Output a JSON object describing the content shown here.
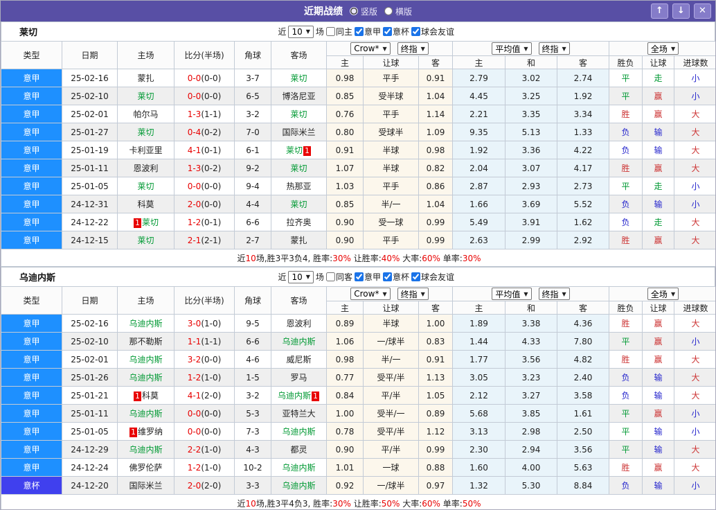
{
  "titlebar": {
    "title": "近期战绩",
    "radio_vertical": "竖版",
    "radio_horizontal": "横版",
    "radio_checked": "checked",
    "up_icon": "↑",
    "down_icon": "↓",
    "close_icon": "✕"
  },
  "colors": {
    "titlebar_bg": "#584fa5",
    "button_bg": "#857cc9",
    "serie_a_bg": "#1e90ff",
    "cup_bg": "#4040ee",
    "focus_team_green": "#009933",
    "score_red": "#e80000",
    "result_red": "#cc3333",
    "result_green": "#009933",
    "result_blue": "#2525cc",
    "odds_col_bg": "#fcf7ec",
    "avg_col_bg": "#e9f4fa"
  },
  "filter": {
    "near_label": "近",
    "count_value": "10",
    "games_label": "场",
    "on": "checked",
    "leagues": [
      "意甲",
      "意杯",
      "球会友谊"
    ]
  },
  "columns": {
    "type": "类型",
    "date": "日期",
    "home": "主场",
    "score": "比分(半场)",
    "corner": "角球",
    "away": "客场",
    "crown_select": "Crow*",
    "final_select": "终指",
    "avg_select": "平均值",
    "full_select": "全场",
    "odds_home": "主",
    "odds_line": "让球",
    "odds_away": "客",
    "avg_home": "主",
    "avg_draw": "和",
    "avg_away": "客",
    "res_outcome": "胜负",
    "res_handicap": "让球",
    "res_goals": "进球数"
  },
  "tables": [
    {
      "team": "莱切",
      "same_label": "同主",
      "rows": [
        {
          "type": "意甲",
          "tclass": "jia",
          "date": "25-02-16",
          "home": {
            "n": "蒙扎",
            "g": false
          },
          "score": "0-0",
          "half": "(0-0)",
          "corner": "3-7",
          "away": {
            "n": "莱切",
            "g": true
          },
          "odds": [
            "0.98",
            "平手",
            "0.91"
          ],
          "avg": [
            "2.79",
            "3.02",
            "2.74"
          ],
          "res": [
            {
              "t": "平",
              "c": "g"
            },
            {
              "t": "走",
              "c": "g"
            },
            {
              "t": "小",
              "c": "b"
            }
          ]
        },
        {
          "type": "意甲",
          "tclass": "jia",
          "date": "25-02-10",
          "home": {
            "n": "莱切",
            "g": true
          },
          "score": "0-0",
          "half": "(0-0)",
          "corner": "6-5",
          "away": {
            "n": "博洛尼亚",
            "g": false
          },
          "odds": [
            "0.85",
            "受半球",
            "1.04"
          ],
          "avg": [
            "4.45",
            "3.25",
            "1.92"
          ],
          "res": [
            {
              "t": "平",
              "c": "g"
            },
            {
              "t": "赢",
              "c": "r"
            },
            {
              "t": "小",
              "c": "b"
            }
          ]
        },
        {
          "type": "意甲",
          "tclass": "jia",
          "date": "25-02-01",
          "home": {
            "n": "帕尔马",
            "g": false
          },
          "score": "1-3",
          "half": "(1-1)",
          "corner": "3-2",
          "away": {
            "n": "莱切",
            "g": true
          },
          "odds": [
            "0.76",
            "平手",
            "1.14"
          ],
          "avg": [
            "2.21",
            "3.35",
            "3.34"
          ],
          "res": [
            {
              "t": "胜",
              "c": "r"
            },
            {
              "t": "赢",
              "c": "r"
            },
            {
              "t": "大",
              "c": "r"
            }
          ]
        },
        {
          "type": "意甲",
          "tclass": "jia",
          "date": "25-01-27",
          "home": {
            "n": "莱切",
            "g": true
          },
          "score": "0-4",
          "half": "(0-2)",
          "corner": "7-0",
          "away": {
            "n": "国际米兰",
            "g": false
          },
          "odds": [
            "0.80",
            "受球半",
            "1.09"
          ],
          "avg": [
            "9.35",
            "5.13",
            "1.33"
          ],
          "res": [
            {
              "t": "负",
              "c": "b"
            },
            {
              "t": "输",
              "c": "b"
            },
            {
              "t": "大",
              "c": "r"
            }
          ]
        },
        {
          "type": "意甲",
          "tclass": "jia",
          "date": "25-01-19",
          "home": {
            "n": "卡利亚里",
            "g": false
          },
          "score": "4-1",
          "half": "(0-1)",
          "corner": "6-1",
          "away": {
            "n": "莱切",
            "g": true,
            "badge": "1",
            "bpos": "after"
          },
          "odds": [
            "0.91",
            "半球",
            "0.98"
          ],
          "avg": [
            "1.92",
            "3.36",
            "4.22"
          ],
          "res": [
            {
              "t": "负",
              "c": "b"
            },
            {
              "t": "输",
              "c": "b"
            },
            {
              "t": "大",
              "c": "r"
            }
          ]
        },
        {
          "type": "意甲",
          "tclass": "jia",
          "date": "25-01-11",
          "home": {
            "n": "恩波利",
            "g": false
          },
          "score": "1-3",
          "half": "(0-2)",
          "corner": "9-2",
          "away": {
            "n": "莱切",
            "g": true
          },
          "odds": [
            "1.07",
            "半球",
            "0.82"
          ],
          "avg": [
            "2.04",
            "3.07",
            "4.17"
          ],
          "res": [
            {
              "t": "胜",
              "c": "r"
            },
            {
              "t": "赢",
              "c": "r"
            },
            {
              "t": "大",
              "c": "r"
            }
          ]
        },
        {
          "type": "意甲",
          "tclass": "jia",
          "date": "25-01-05",
          "home": {
            "n": "莱切",
            "g": true
          },
          "score": "0-0",
          "half": "(0-0)",
          "corner": "9-4",
          "away": {
            "n": "热那亚",
            "g": false
          },
          "odds": [
            "1.03",
            "平手",
            "0.86"
          ],
          "avg": [
            "2.87",
            "2.93",
            "2.73"
          ],
          "res": [
            {
              "t": "平",
              "c": "g"
            },
            {
              "t": "走",
              "c": "g"
            },
            {
              "t": "小",
              "c": "b"
            }
          ]
        },
        {
          "type": "意甲",
          "tclass": "jia",
          "date": "24-12-31",
          "home": {
            "n": "科莫",
            "g": false
          },
          "score": "2-0",
          "half": "(0-0)",
          "corner": "4-4",
          "away": {
            "n": "莱切",
            "g": true
          },
          "odds": [
            "0.85",
            "半/一",
            "1.04"
          ],
          "avg": [
            "1.66",
            "3.69",
            "5.52"
          ],
          "res": [
            {
              "t": "负",
              "c": "b"
            },
            {
              "t": "输",
              "c": "b"
            },
            {
              "t": "小",
              "c": "b"
            }
          ]
        },
        {
          "type": "意甲",
          "tclass": "jia",
          "date": "24-12-22",
          "home": {
            "n": "莱切",
            "g": true,
            "badge": "1",
            "bpos": "before"
          },
          "score": "1-2",
          "half": "(0-1)",
          "corner": "6-6",
          "away": {
            "n": "拉齐奥",
            "g": false
          },
          "odds": [
            "0.90",
            "受一球",
            "0.99"
          ],
          "avg": [
            "5.49",
            "3.91",
            "1.62"
          ],
          "res": [
            {
              "t": "负",
              "c": "b"
            },
            {
              "t": "走",
              "c": "g"
            },
            {
              "t": "大",
              "c": "r"
            }
          ]
        },
        {
          "type": "意甲",
          "tclass": "jia",
          "date": "24-12-15",
          "home": {
            "n": "莱切",
            "g": true
          },
          "score": "2-1",
          "half": "(2-1)",
          "corner": "2-7",
          "away": {
            "n": "蒙扎",
            "g": false
          },
          "odds": [
            "0.90",
            "平手",
            "0.99"
          ],
          "avg": [
            "2.63",
            "2.99",
            "2.92"
          ],
          "res": [
            {
              "t": "胜",
              "c": "r"
            },
            {
              "t": "赢",
              "c": "r"
            },
            {
              "t": "大",
              "c": "r"
            }
          ]
        }
      ],
      "summary": [
        {
          "t": "近"
        },
        {
          "t": "10",
          "r": true
        },
        {
          "t": "场,胜3平3负4, 胜率:"
        },
        {
          "t": "30%",
          "r": true
        },
        {
          "t": " 让胜率:"
        },
        {
          "t": "40%",
          "r": true
        },
        {
          "t": " 大率:"
        },
        {
          "t": "60%",
          "r": true
        },
        {
          "t": " 单率:"
        },
        {
          "t": "30%",
          "r": true
        }
      ]
    },
    {
      "team": "乌迪内斯",
      "same_label": "同客",
      "rows": [
        {
          "type": "意甲",
          "tclass": "jia",
          "date": "25-02-16",
          "home": {
            "n": "乌迪内斯",
            "g": true
          },
          "score": "3-0",
          "half": "(1-0)",
          "corner": "9-5",
          "away": {
            "n": "恩波利",
            "g": false
          },
          "odds": [
            "0.89",
            "半球",
            "1.00"
          ],
          "avg": [
            "1.89",
            "3.38",
            "4.36"
          ],
          "res": [
            {
              "t": "胜",
              "c": "r"
            },
            {
              "t": "赢",
              "c": "r"
            },
            {
              "t": "大",
              "c": "r"
            }
          ]
        },
        {
          "type": "意甲",
          "tclass": "jia",
          "date": "25-02-10",
          "home": {
            "n": "那不勒斯",
            "g": false
          },
          "score": "1-1",
          "half": "(1-1)",
          "corner": "6-6",
          "away": {
            "n": "乌迪内斯",
            "g": true
          },
          "odds": [
            "1.06",
            "一/球半",
            "0.83"
          ],
          "avg": [
            "1.44",
            "4.33",
            "7.80"
          ],
          "res": [
            {
              "t": "平",
              "c": "g"
            },
            {
              "t": "赢",
              "c": "r"
            },
            {
              "t": "小",
              "c": "b"
            }
          ]
        },
        {
          "type": "意甲",
          "tclass": "jia",
          "date": "25-02-01",
          "home": {
            "n": "乌迪内斯",
            "g": true
          },
          "score": "3-2",
          "half": "(0-0)",
          "corner": "4-6",
          "away": {
            "n": "威尼斯",
            "g": false
          },
          "odds": [
            "0.98",
            "半/一",
            "0.91"
          ],
          "avg": [
            "1.77",
            "3.56",
            "4.82"
          ],
          "res": [
            {
              "t": "胜",
              "c": "r"
            },
            {
              "t": "赢",
              "c": "r"
            },
            {
              "t": "大",
              "c": "r"
            }
          ]
        },
        {
          "type": "意甲",
          "tclass": "jia",
          "date": "25-01-26",
          "home": {
            "n": "乌迪内斯",
            "g": true
          },
          "score": "1-2",
          "half": "(1-0)",
          "corner": "1-5",
          "away": {
            "n": "罗马",
            "g": false
          },
          "odds": [
            "0.77",
            "受平/半",
            "1.13"
          ],
          "avg": [
            "3.05",
            "3.23",
            "2.40"
          ],
          "res": [
            {
              "t": "负",
              "c": "b"
            },
            {
              "t": "输",
              "c": "b"
            },
            {
              "t": "大",
              "c": "r"
            }
          ]
        },
        {
          "type": "意甲",
          "tclass": "jia",
          "date": "25-01-21",
          "home": {
            "n": "科莫",
            "g": false,
            "badge": "1",
            "bpos": "before"
          },
          "score": "4-1",
          "half": "(2-0)",
          "corner": "3-2",
          "away": {
            "n": "乌迪内斯",
            "g": true,
            "badge": "1",
            "bpos": "after"
          },
          "odds": [
            "0.84",
            "平/半",
            "1.05"
          ],
          "avg": [
            "2.12",
            "3.27",
            "3.58"
          ],
          "res": [
            {
              "t": "负",
              "c": "b"
            },
            {
              "t": "输",
              "c": "b"
            },
            {
              "t": "大",
              "c": "r"
            }
          ]
        },
        {
          "type": "意甲",
          "tclass": "jia",
          "date": "25-01-11",
          "home": {
            "n": "乌迪内斯",
            "g": true
          },
          "score": "0-0",
          "half": "(0-0)",
          "corner": "5-3",
          "away": {
            "n": "亚特兰大",
            "g": false
          },
          "odds": [
            "1.00",
            "受半/一",
            "0.89"
          ],
          "avg": [
            "5.68",
            "3.85",
            "1.61"
          ],
          "res": [
            {
              "t": "平",
              "c": "g"
            },
            {
              "t": "赢",
              "c": "r"
            },
            {
              "t": "小",
              "c": "b"
            }
          ]
        },
        {
          "type": "意甲",
          "tclass": "jia",
          "date": "25-01-05",
          "home": {
            "n": "维罗纳",
            "g": false,
            "badge": "1",
            "bpos": "before"
          },
          "score": "0-0",
          "half": "(0-0)",
          "corner": "7-3",
          "away": {
            "n": "乌迪内斯",
            "g": true
          },
          "odds": [
            "0.78",
            "受平/半",
            "1.12"
          ],
          "avg": [
            "3.13",
            "2.98",
            "2.50"
          ],
          "res": [
            {
              "t": "平",
              "c": "g"
            },
            {
              "t": "输",
              "c": "b"
            },
            {
              "t": "小",
              "c": "b"
            }
          ]
        },
        {
          "type": "意甲",
          "tclass": "jia",
          "date": "24-12-29",
          "home": {
            "n": "乌迪内斯",
            "g": true
          },
          "score": "2-2",
          "half": "(1-0)",
          "corner": "4-3",
          "away": {
            "n": "都灵",
            "g": false
          },
          "odds": [
            "0.90",
            "平/半",
            "0.99"
          ],
          "avg": [
            "2.30",
            "2.94",
            "3.56"
          ],
          "res": [
            {
              "t": "平",
              "c": "g"
            },
            {
              "t": "输",
              "c": "b"
            },
            {
              "t": "大",
              "c": "r"
            }
          ]
        },
        {
          "type": "意甲",
          "tclass": "jia",
          "date": "24-12-24",
          "home": {
            "n": "佛罗伦萨",
            "g": false
          },
          "score": "1-2",
          "half": "(1-0)",
          "corner": "10-2",
          "away": {
            "n": "乌迪内斯",
            "g": true
          },
          "odds": [
            "1.01",
            "一球",
            "0.88"
          ],
          "avg": [
            "1.60",
            "4.00",
            "5.63"
          ],
          "res": [
            {
              "t": "胜",
              "c": "r"
            },
            {
              "t": "赢",
              "c": "r"
            },
            {
              "t": "大",
              "c": "r"
            }
          ]
        },
        {
          "type": "意杯",
          "tclass": "cup",
          "date": "24-12-20",
          "home": {
            "n": "国际米兰",
            "g": false
          },
          "score": "2-0",
          "half": "(2-0)",
          "corner": "3-3",
          "away": {
            "n": "乌迪内斯",
            "g": true
          },
          "odds": [
            "0.92",
            "一/球半",
            "0.97"
          ],
          "avg": [
            "1.32",
            "5.30",
            "8.84"
          ],
          "res": [
            {
              "t": "负",
              "c": "b"
            },
            {
              "t": "输",
              "c": "b"
            },
            {
              "t": "小",
              "c": "b"
            }
          ]
        }
      ],
      "summary": [
        {
          "t": "近"
        },
        {
          "t": "10",
          "r": true
        },
        {
          "t": "场,胜3平4负3, 胜率:"
        },
        {
          "t": "30%",
          "r": true
        },
        {
          "t": " 让胜率:"
        },
        {
          "t": "50%",
          "r": true
        },
        {
          "t": " 大率:"
        },
        {
          "t": "60%",
          "r": true
        },
        {
          "t": " 单率:"
        },
        {
          "t": "50%",
          "r": true
        }
      ]
    }
  ]
}
